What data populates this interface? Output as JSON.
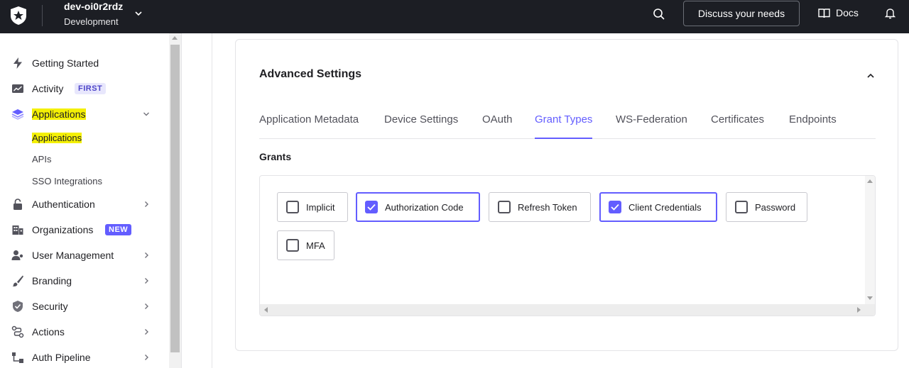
{
  "topbar": {
    "tenant_name": "dev-oi0r2rdz",
    "tenant_env": "Development",
    "discuss_label": "Discuss your needs",
    "docs_label": "Docs"
  },
  "sidebar": {
    "items": [
      {
        "label": "Getting Started",
        "icon": "bolt-icon"
      },
      {
        "label": "Activity",
        "icon": "activity-chart-icon",
        "badge": "FIRST"
      },
      {
        "label": "Applications",
        "icon": "layers-icon"
      },
      {
        "label": "Authentication",
        "icon": "lock-icon"
      },
      {
        "label": "Organizations",
        "icon": "buildings-icon",
        "badge": "NEW"
      },
      {
        "label": "User Management",
        "icon": "users-icon"
      },
      {
        "label": "Branding",
        "icon": "brush-icon"
      },
      {
        "label": "Security",
        "icon": "shield-icon"
      },
      {
        "label": "Actions",
        "icon": "flow-icon"
      },
      {
        "label": "Auth Pipeline",
        "icon": "pipeline-icon"
      }
    ],
    "sub_items": [
      "Applications",
      "APIs",
      "SSO Integrations"
    ]
  },
  "main": {
    "section_title": "Advanced Settings",
    "tabs": [
      "Application Metadata",
      "Device Settings",
      "OAuth",
      "Grant Types",
      "WS-Federation",
      "Certificates",
      "Endpoints"
    ],
    "active_tab": "Grant Types",
    "grants_label": "Grants",
    "grants": [
      {
        "label": "Implicit",
        "checked": false
      },
      {
        "label": "Authorization Code",
        "checked": true
      },
      {
        "label": "Refresh Token",
        "checked": false
      },
      {
        "label": "Client Credentials",
        "checked": true
      },
      {
        "label": "Password",
        "checked": false
      },
      {
        "label": "MFA",
        "checked": false
      }
    ]
  },
  "colors": {
    "accent": "#635dff",
    "topbar_bg": "#1c1e24",
    "highlight": "#f4f005"
  }
}
